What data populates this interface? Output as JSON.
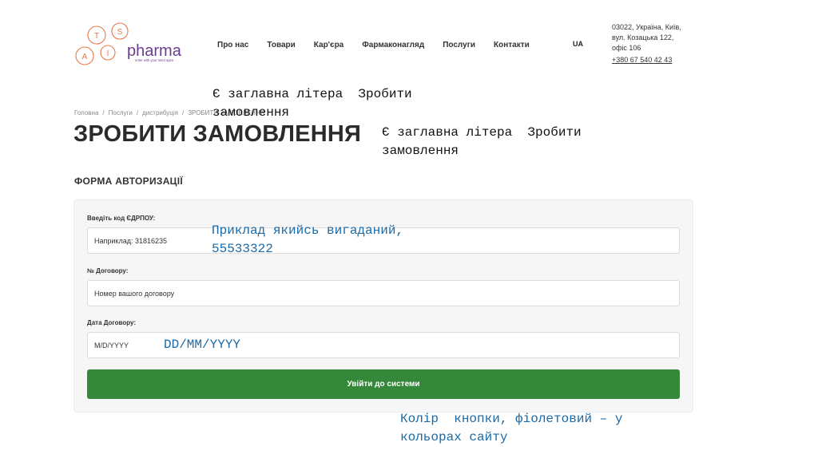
{
  "header": {
    "logo": {
      "letters": [
        "A",
        "T",
        "I",
        "S"
      ],
      "brand": "pharma",
      "tagline": "enter with your mind open",
      "color_orange": "#e8784a",
      "color_purple": "#6a3c8f"
    },
    "nav": [
      "Про нас",
      "Товари",
      "Кар'єра",
      "Фармаконагляд",
      "Послуги",
      "Контакти"
    ],
    "lang": "UA",
    "address": [
      "03022, Україна, Київ,",
      "вул. Козацька 122,",
      "офіс 106"
    ],
    "phone": "+380 67 540 42 43"
  },
  "breadcrumb": [
    "Головна",
    "Послуги",
    "дистрибуція",
    "ЗРОБИТИ ЗАМОВЛЕННЯ"
  ],
  "title": "ЗРОБИТИ ЗАМОВЛЕННЯ",
  "form": {
    "heading": "ФОРМА АВТОРИЗАЦІЇ",
    "fields": [
      {
        "label": "Введіть код ЄДРПОУ:",
        "placeholder": "Наприклад: 31816235"
      },
      {
        "label": "№ Договору:",
        "placeholder": "Номер вашого договору"
      },
      {
        "label": "Дата Договору:",
        "placeholder": "M/D/YYYY"
      }
    ],
    "submit": "Увійти до системи",
    "button_color": "#35873a"
  },
  "annotations": [
    "Є заглавна літера  Зробити\nзамовлення",
    "Є заглавна літера  Зробити\nзамовлення",
    "Приклад якийсь вигаданий,\n55533322",
    "DD/MM/YYYY",
    "Колір  кнопки, фіолетовий – у\nкольорах сайту"
  ]
}
